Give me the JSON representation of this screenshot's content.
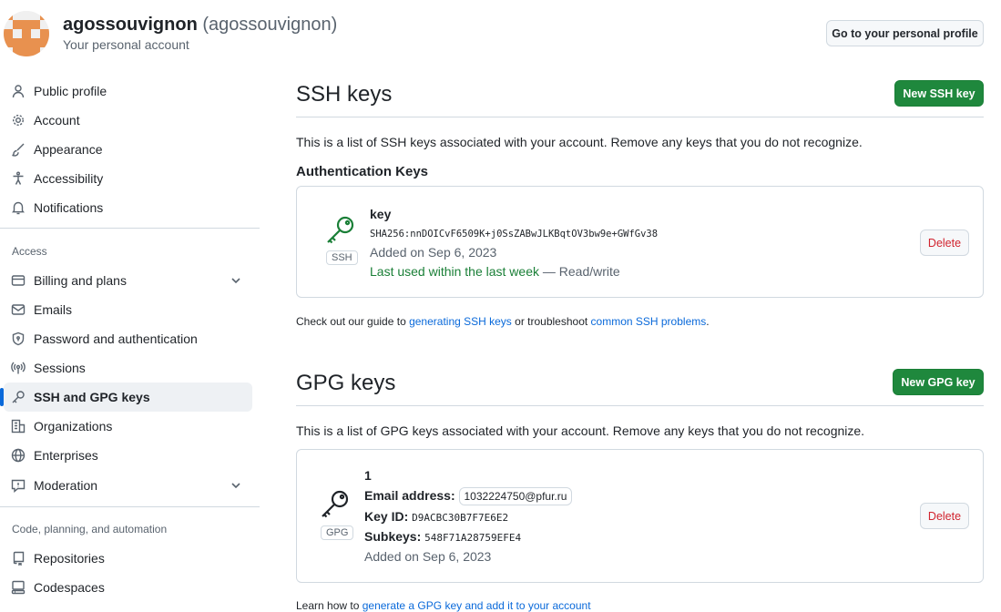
{
  "account": {
    "name": "agossouvignon",
    "login": "(agossouvignon)",
    "subtitle": "Your personal account",
    "profile_button": "Go to your personal profile"
  },
  "sidebar": {
    "group1": [
      {
        "label": "Public profile",
        "icon": "person-icon"
      },
      {
        "label": "Account",
        "icon": "gear-icon"
      },
      {
        "label": "Appearance",
        "icon": "paintbrush-icon"
      },
      {
        "label": "Accessibility",
        "icon": "accessibility-icon"
      },
      {
        "label": "Notifications",
        "icon": "bell-icon"
      }
    ],
    "access_heading": "Access",
    "access": [
      {
        "label": "Billing and plans",
        "icon": "credit-card-icon",
        "expandable": true
      },
      {
        "label": "Emails",
        "icon": "mail-icon"
      },
      {
        "label": "Password and authentication",
        "icon": "shield-lock-icon"
      },
      {
        "label": "Sessions",
        "icon": "broadcast-icon"
      },
      {
        "label": "SSH and GPG keys",
        "icon": "key-icon",
        "active": true
      },
      {
        "label": "Organizations",
        "icon": "organization-icon"
      },
      {
        "label": "Enterprises",
        "icon": "globe-icon"
      },
      {
        "label": "Moderation",
        "icon": "report-icon",
        "expandable": true
      }
    ],
    "code_heading": "Code, planning, and automation",
    "code": [
      {
        "label": "Repositories",
        "icon": "repo-icon"
      },
      {
        "label": "Codespaces",
        "icon": "codespaces-icon"
      }
    ]
  },
  "ssh": {
    "title": "SSH keys",
    "new_button": "New SSH key",
    "description": "This is a list of SSH keys associated with your account. Remove any keys that you do not recognize.",
    "auth_heading": "Authentication Keys",
    "key": {
      "name": "key",
      "fingerprint": "SHA256:nnDOICvF6509K+j0SsZABwJLKBqtOV3bw9e+GWfGv38",
      "added": "Added on Sep 6, 2023",
      "last_used": "Last used within the last week",
      "access": " — Read/write",
      "badge": "SSH",
      "delete": "Delete"
    },
    "guide_prefix": "Check out our guide to ",
    "guide_link1": "generating SSH keys",
    "guide_mid": " or troubleshoot ",
    "guide_link2": "common SSH problems",
    "guide_suffix": "."
  },
  "gpg": {
    "title": "GPG keys",
    "new_button": "New GPG key",
    "description": "This is a list of GPG keys associated with your account. Remove any keys that you do not recognize.",
    "key": {
      "name": "1",
      "email_label": "Email address:",
      "email": "1032224750@pfur.ru",
      "keyid_label": "Key ID:",
      "keyid": "D9ACBC30B7F7E6E2",
      "subkeys_label": "Subkeys:",
      "subkeys": "548F71A28759EFE4",
      "added": "Added on Sep 6, 2023",
      "badge": "GPG",
      "delete": "Delete"
    },
    "learn_prefix": "Learn how to ",
    "learn_link": "generate a GPG key and add it to your account"
  },
  "colors": {
    "accent": "#0969da",
    "success": "#1a7f37",
    "danger": "#d1242f",
    "primary_button": "#1f883d",
    "avatar": "#e8914f"
  }
}
